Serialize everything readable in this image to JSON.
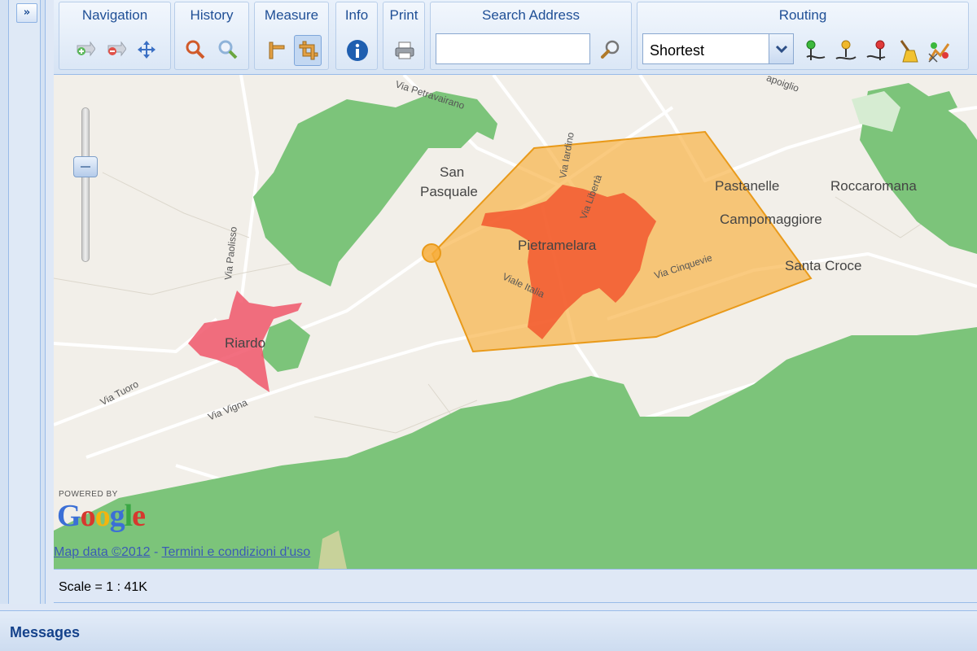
{
  "sidebar": {
    "expand_label": "»"
  },
  "toolbar": {
    "groups": {
      "navigation": {
        "title": "Navigation",
        "buttons": [
          "zoom-in-pan-icon",
          "zoom-out-pan-icon",
          "pan-move-icon"
        ]
      },
      "history": {
        "title": "History",
        "buttons": [
          "history-back-icon",
          "history-forward-icon"
        ]
      },
      "measure": {
        "title": "Measure",
        "buttons": [
          "measure-line-icon",
          "measure-area-icon"
        ],
        "active": "measure-area-icon"
      },
      "info": {
        "title": "Info",
        "buttons": [
          "info-icon"
        ]
      },
      "print": {
        "title": "Print",
        "buttons": [
          "printer-icon"
        ]
      },
      "search": {
        "title": "Search Address",
        "value": "",
        "placeholder": ""
      },
      "routing": {
        "title": "Routing",
        "selected_option": "Shortest",
        "buttons": [
          "route-start-icon",
          "route-via-icon",
          "route-end-icon",
          "route-clear-icon",
          "route-calculate-icon"
        ]
      }
    }
  },
  "map": {
    "places": {
      "san_pasquale_1": "San",
      "san_pasquale_2": "Pasquale",
      "pastanelle": "Pastanelle",
      "roccaromana": "Roccaromana",
      "campomaggiore": "Campomaggiore",
      "pietramelara": "Pietramelara",
      "santa_croce": "Santa Croce",
      "riardo": "Riardo"
    },
    "roads": {
      "petravairano": "Via Petravairano",
      "iardino": "Via Iardino",
      "liberta": "Via Libertà",
      "cinquevie": "Via Cinquevie",
      "italia": "Viale Italia",
      "paolisso": "Via Paolisso",
      "tuoro": "Via Tuoro",
      "vigna": "Via Vigna",
      "capoiglio": "apoiglio"
    },
    "branding": {
      "powered_by": "POWERED BY",
      "google": "Google"
    },
    "attribution": {
      "map_data": "Map data ©2012",
      "separator": " - ",
      "terms": "Termini e condizioni d'uso"
    },
    "colors": {
      "land": "#f2efe9",
      "vegetation": "#7cc47a",
      "polygon_fill": "#f7ad3b",
      "town_highlight": "#f2502a",
      "riardo_highlight": "#f0566a"
    }
  },
  "status": {
    "scale": "Scale = 1 : 41K"
  },
  "messages": {
    "title": "Messages"
  }
}
